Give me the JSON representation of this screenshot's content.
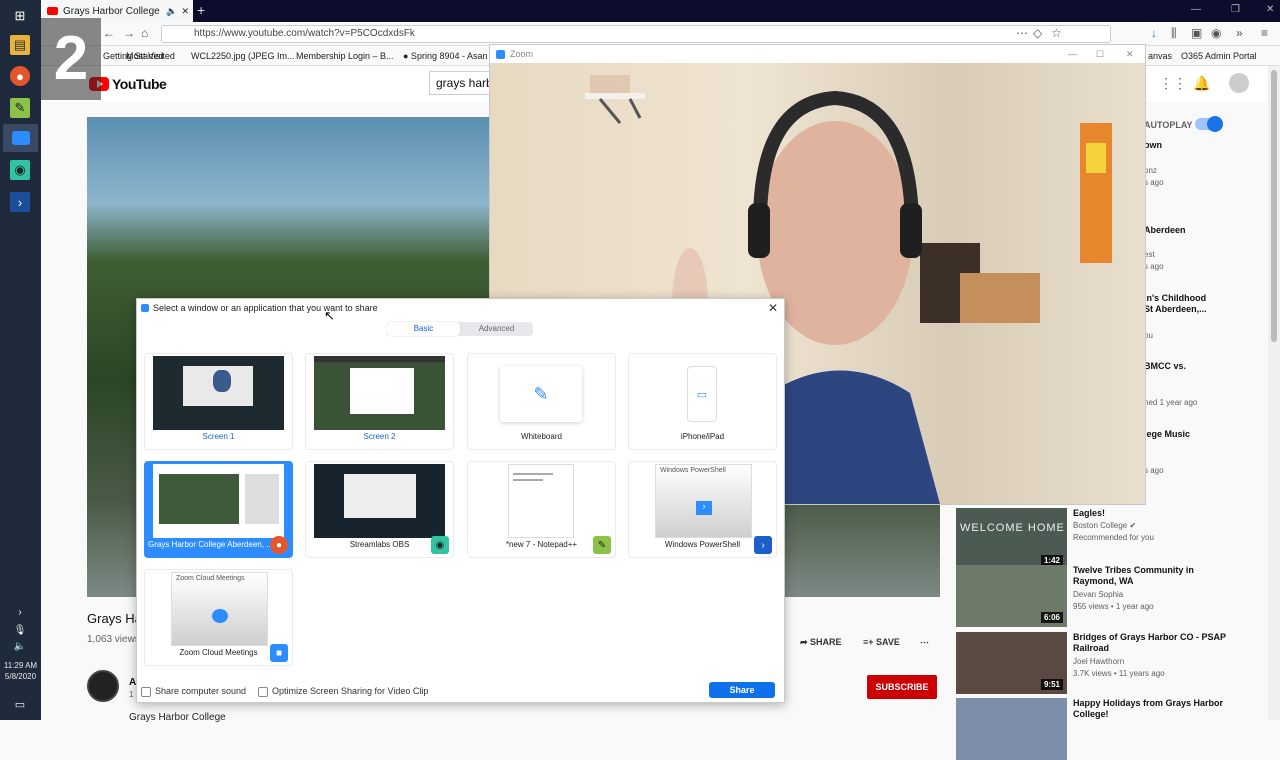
{
  "slide_number": "2",
  "taskbar": {
    "time": "11:29 AM",
    "date": "5/8/2020"
  },
  "browser": {
    "tab_title": "Grays Harbor College Aberdeen",
    "url": "https://www.youtube.com/watch?v=P5COcdxdsFk",
    "bookmarks": [
      "Getting Started",
      "Most Visited",
      "WCL2250.jpg (JPEG Im...",
      "Membership Login – B...",
      "● Spring 8904 - Asan",
      "anvas",
      "O365 Admin Portal"
    ]
  },
  "youtube": {
    "logo_text": "YouTube",
    "search_value": "grays harbor",
    "video_title": "Grays Har",
    "views": "1,063 views",
    "share_label": "SHARE",
    "save_label": "SAVE",
    "subscribe_label": "SUBSCRIBE",
    "channel_name": "Grays Harbor College",
    "channel_abbrev": "A",
    "channel_subcount": "1",
    "autoplay_label": "AUTOPLAY",
    "sidebar_fragments": [
      {
        "t": "own",
        "sub": false
      },
      {
        "t": "onz",
        "sub": true
      },
      {
        "t": "s ago",
        "sub": true
      },
      {
        "t": "Aberdeen",
        "sub": false
      },
      {
        "t": "est",
        "sub": true
      },
      {
        "t": "s ago",
        "sub": true
      },
      {
        "t": "in's Childhood",
        "sub": false
      },
      {
        "t": "St Aberdeen,...",
        "sub": false
      },
      {
        "t": "ou",
        "sub": true
      },
      {
        "t": "BMCC vs.",
        "sub": false
      },
      {
        "t": "hed 1 year ago",
        "sub": true
      },
      {
        "t": "lege Music",
        "sub": false
      },
      {
        "t": "s ago",
        "sub": true
      }
    ],
    "recommendations": [
      {
        "title": "Eagles!",
        "channel": "Boston College ✔",
        "meta": "Recommended for you",
        "duration": "1:42",
        "thumb_text": "WELCOME HOME"
      },
      {
        "title": "Twelve Tribes Community in Raymond, WA",
        "channel": "Devan Sophia",
        "meta": "955 views • 1 year ago",
        "duration": "6:06",
        "thumb_text": ""
      },
      {
        "title": "Bridges of Grays Harbor CO - PSAP Railroad",
        "channel": "Joel Hawthorn",
        "meta": "3.7K views • 11 years ago",
        "duration": "9:51",
        "thumb_text": ""
      },
      {
        "title": "Happy Holidays from Grays Harbor College!",
        "channel": "",
        "meta": "",
        "duration": "",
        "thumb_text": ""
      }
    ]
  },
  "zoom_window": {
    "title": "Zoom"
  },
  "share_dialog": {
    "title": "Select a window or an application that you want to share",
    "tabs": [
      "Basic",
      "Advanced"
    ],
    "active_tab": "Basic",
    "tiles": [
      {
        "label": "Screen 1",
        "kind": "screen"
      },
      {
        "label": "Screen 2",
        "kind": "screen"
      },
      {
        "label": "Whiteboard",
        "kind": "whiteboard"
      },
      {
        "label": "iPhone/iPad",
        "kind": "iphone"
      },
      {
        "label": "Grays Harbor College Aberdeen, ...",
        "kind": "firefox",
        "selected": true
      },
      {
        "label": "Streamlabs OBS",
        "kind": "obs"
      },
      {
        "label": "*new 7 - Notepad++",
        "kind": "notepad"
      },
      {
        "label": "Windows PowerShell",
        "kind": "powershell",
        "preview_title": "Windows PowerShell"
      },
      {
        "label": "Zoom Cloud Meetings",
        "kind": "zoom",
        "preview_title": "Zoom Cloud Meetings"
      }
    ],
    "share_computer_sound": "Share computer sound",
    "optimize_label": "Optimize Screen Sharing for Video Clip",
    "share_button": "Share"
  },
  "colors": {
    "zoom_blue": "#0e71eb",
    "youtube_red": "#ff0000",
    "subscribe_red": "#cc0000",
    "taskbar": "#1f2a3c"
  }
}
